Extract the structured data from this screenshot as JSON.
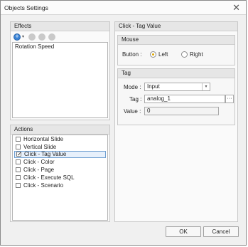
{
  "window": {
    "title": "Objects Settings",
    "close_symbol": "✕"
  },
  "effects": {
    "heading": "Effects",
    "items": [
      "Rotation Speed"
    ]
  },
  "actions": {
    "heading": "Actions",
    "items": [
      {
        "label": "Horizontal Slide",
        "checked": false
      },
      {
        "label": "Vertical Slide",
        "checked": false
      },
      {
        "label": "Click - Tag Value",
        "checked": true
      },
      {
        "label": "Click - Color",
        "checked": false
      },
      {
        "label": "Click - Page",
        "checked": false
      },
      {
        "label": "Click - Execute SQL",
        "checked": false
      },
      {
        "label": "Click - Scenario",
        "checked": false
      }
    ]
  },
  "detail": {
    "heading": "Click - Tag Value",
    "mouse": {
      "heading": "Mouse",
      "button_label": "Button :",
      "options": [
        "Left",
        "Right"
      ],
      "selected": "Left"
    },
    "tag": {
      "heading": "Tag",
      "mode_label": "Mode :",
      "mode_value": "Input",
      "tag_label": "Tag :",
      "tag_value": "analog_1",
      "browse_label": "···",
      "value_label": "Value :",
      "value_value": "0"
    }
  },
  "footer": {
    "ok_label": "OK",
    "cancel_label": "Cancel"
  }
}
